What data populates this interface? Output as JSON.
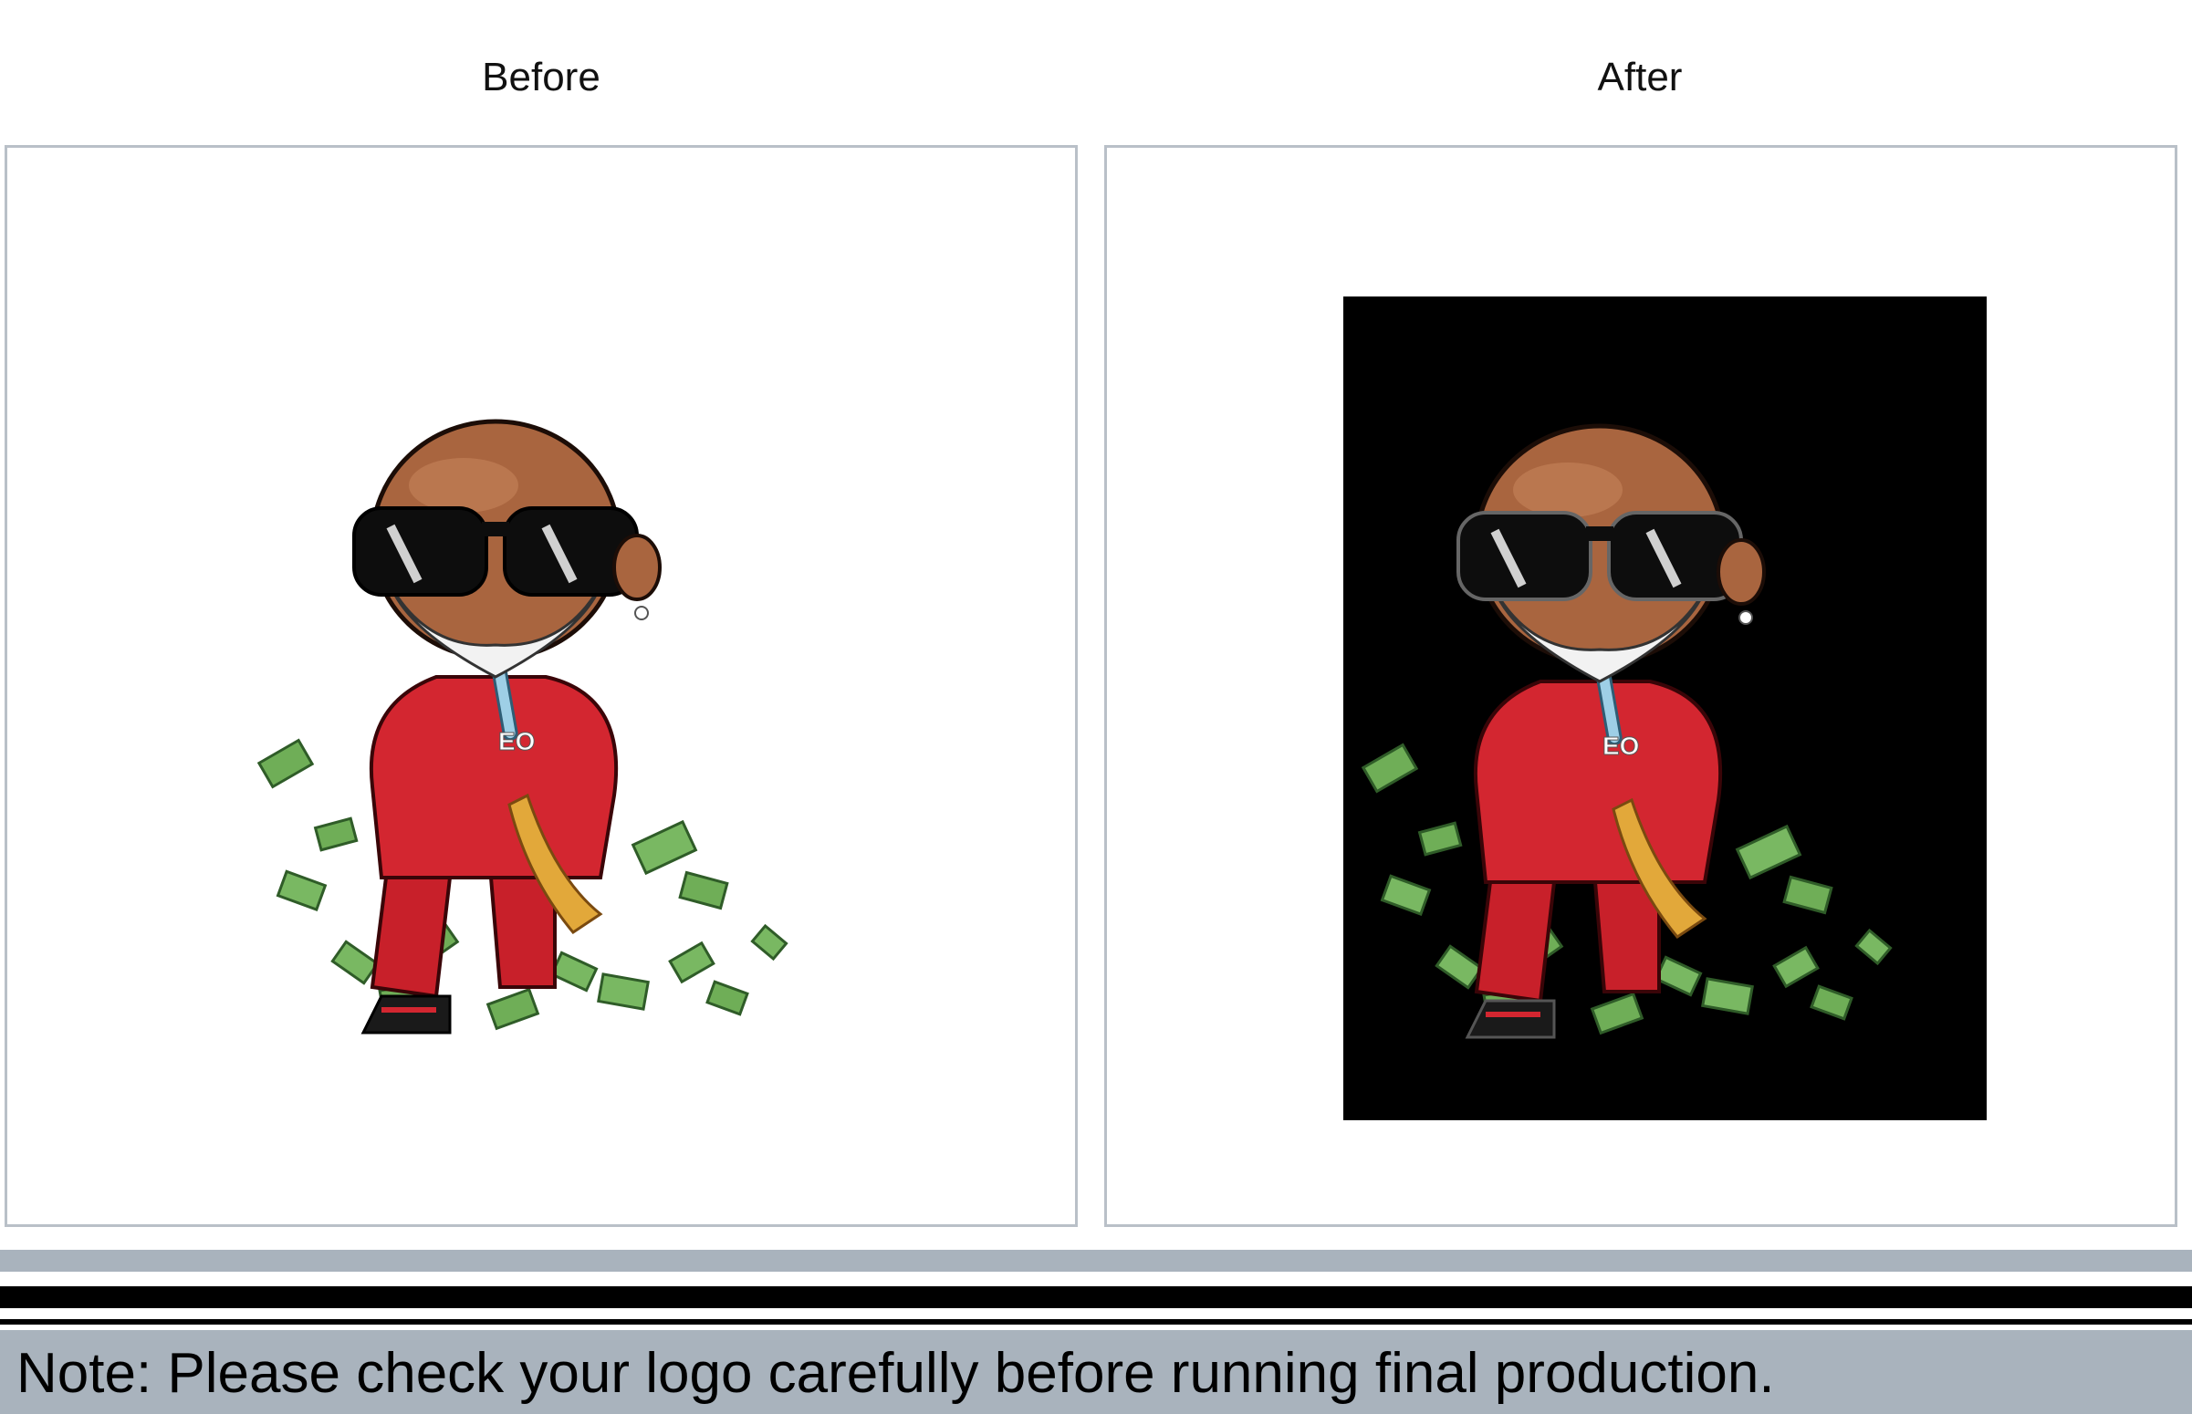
{
  "labels": {
    "before": "Before",
    "after": "After"
  },
  "note": "Note: Please check your logo carefully before running final production.",
  "artwork": {
    "chest_logo_text": "EO",
    "description_icon": "cartoon-character-illustration"
  },
  "colors": {
    "border": "#b9c0c8",
    "bar_gray": "#a9b3bd",
    "after_background": "#000000"
  }
}
